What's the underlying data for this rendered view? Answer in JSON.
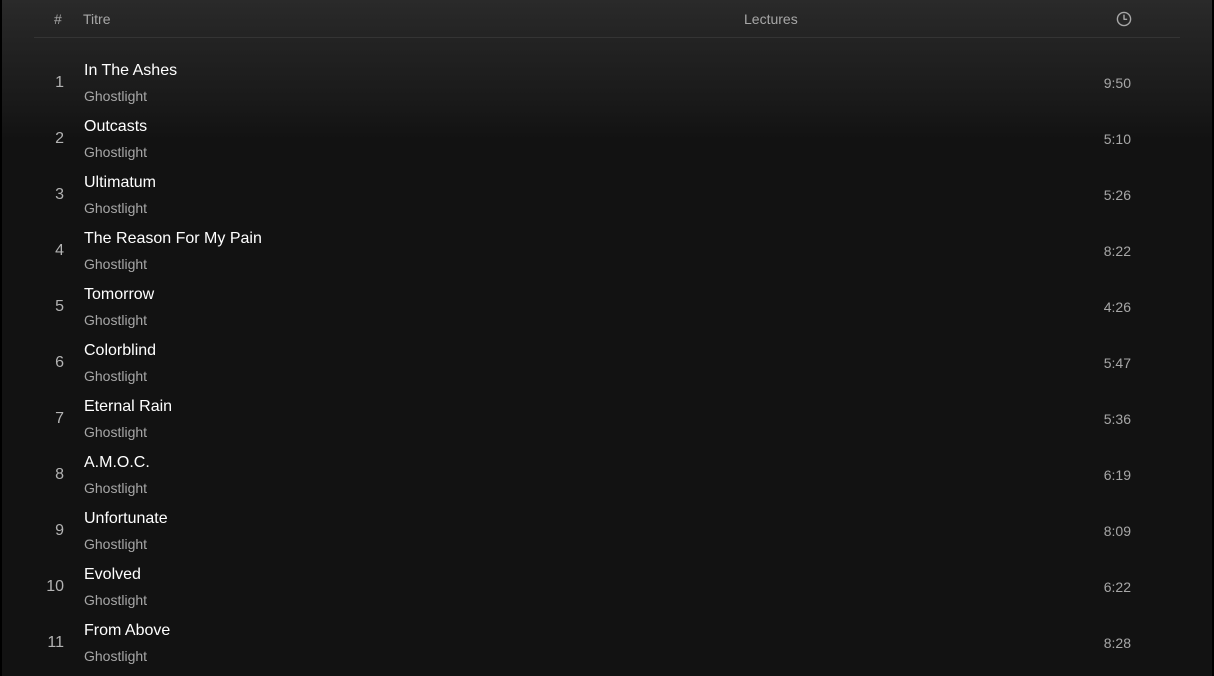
{
  "header": {
    "number_label": "#",
    "title_label": "Titre",
    "plays_label": "Lectures",
    "duration_icon": "clock-icon"
  },
  "colors": {
    "background": "#121212",
    "header_gradient_top": "#2a2a2a",
    "primary_text": "#ffffff",
    "secondary_text": "#a7a7a7",
    "divider": "#343434"
  },
  "tracks": [
    {
      "number": "1",
      "title": "In The Ashes",
      "artist": "Ghostlight",
      "duration": "9:50"
    },
    {
      "number": "2",
      "title": "Outcasts",
      "artist": "Ghostlight",
      "duration": "5:10"
    },
    {
      "number": "3",
      "title": "Ultimatum",
      "artist": "Ghostlight",
      "duration": "5:26"
    },
    {
      "number": "4",
      "title": "The Reason For My Pain",
      "artist": "Ghostlight",
      "duration": "8:22"
    },
    {
      "number": "5",
      "title": "Tomorrow",
      "artist": "Ghostlight",
      "duration": "4:26"
    },
    {
      "number": "6",
      "title": "Colorblind",
      "artist": "Ghostlight",
      "duration": "5:47"
    },
    {
      "number": "7",
      "title": "Eternal Rain",
      "artist": "Ghostlight",
      "duration": "5:36"
    },
    {
      "number": "8",
      "title": "A.M.O.C.",
      "artist": "Ghostlight",
      "duration": "6:19"
    },
    {
      "number": "9",
      "title": "Unfortunate",
      "artist": "Ghostlight",
      "duration": "8:09"
    },
    {
      "number": "10",
      "title": "Evolved",
      "artist": "Ghostlight",
      "duration": "6:22"
    },
    {
      "number": "11",
      "title": "From Above",
      "artist": "Ghostlight",
      "duration": "8:28"
    }
  ]
}
